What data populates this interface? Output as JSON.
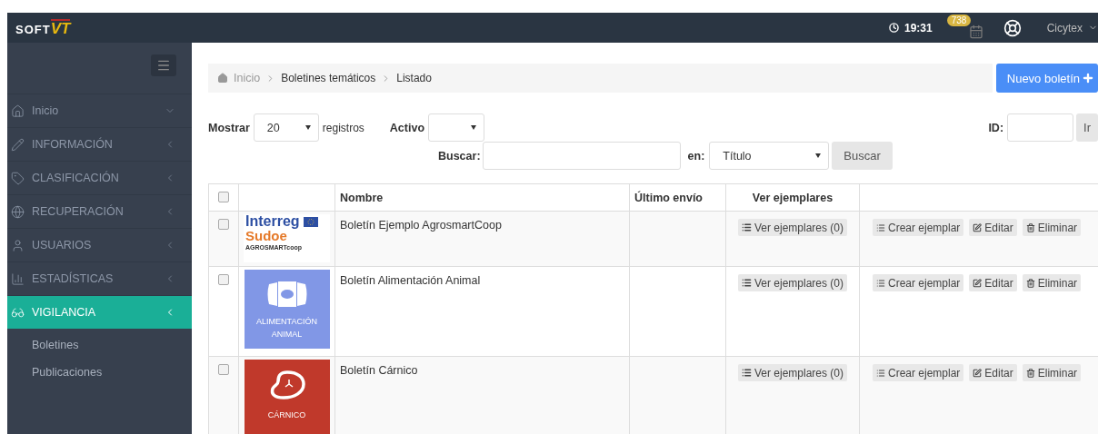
{
  "topbar": {
    "logo": {
      "left": "SOFT",
      "right": "VT"
    },
    "time": "19:31",
    "notifications": "738",
    "user": "Cicytex"
  },
  "sidebar": {
    "items": [
      {
        "label": "Inicio",
        "kind": "link",
        "selected": false
      },
      {
        "label": "INFORMACIÓN",
        "kind": "group",
        "selected": false
      },
      {
        "label": "CLASIFICACIÓN",
        "kind": "group",
        "selected": false
      },
      {
        "label": "RECUPERACIÓN",
        "kind": "group",
        "selected": false
      },
      {
        "label": "USUARIOS",
        "kind": "group",
        "selected": false
      },
      {
        "label": "ESTADÍSTICAS",
        "kind": "group",
        "selected": false
      },
      {
        "label": "VIGILANCIA",
        "kind": "group",
        "selected": true,
        "children": [
          {
            "label": "Boletines"
          },
          {
            "label": "Publicaciones"
          }
        ]
      }
    ]
  },
  "breadcrumb": [
    "Inicio",
    "Boletines temáticos",
    "Listado"
  ],
  "new_button": "Nuevo boletín",
  "filters": {
    "show_label": "Mostrar",
    "show_value": "20",
    "show_suffix": "registros",
    "active_label": "Activo",
    "search_label": "Buscar:",
    "in_label": "en:",
    "in_value": "Título",
    "search_button": "Buscar",
    "id_label": "ID:",
    "id_button": "Ir"
  },
  "table": {
    "header_checked": false,
    "columns": [
      "Nombre",
      "Último envío",
      "Ver ejemplares"
    ],
    "rows": [
      {
        "checked": false,
        "thumbnail": {
          "kind": "logo",
          "lines": [
            "Interreg",
            "Sudoe",
            "AGROSMARTcoop"
          ]
        },
        "name": "Boletín Ejemplo AgrosmartCoop",
        "view": "Ver ejemplares (0)",
        "actions": [
          "Crear ejemplar",
          "Editar",
          "Eliminar"
        ]
      },
      {
        "checked": false,
        "thumbnail": {
          "kind": "tile",
          "color": "#8197e6",
          "lines": [
            "ALIMENTACIÓN",
            "ANIMAL"
          ]
        },
        "name": "Boletín Alimentación Animal",
        "view": "Ver ejemplares (0)",
        "actions": [
          "Crear ejemplar",
          "Editar",
          "Eliminar"
        ]
      },
      {
        "checked": false,
        "thumbnail": {
          "kind": "tile",
          "color": "#c0392b",
          "lines": [
            "CÁRNICO"
          ]
        },
        "name": "Boletín Cárnico",
        "view": "Ver ejemplares (0)",
        "actions": [
          "Crear ejemplar",
          "Editar",
          "Eliminar"
        ]
      }
    ]
  }
}
